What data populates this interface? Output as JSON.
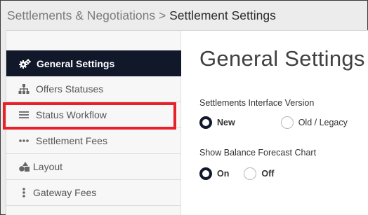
{
  "breadcrumb": {
    "parent": "Settlements & Negotiations",
    "separator": ">",
    "current": "Settlement Settings"
  },
  "sidebar": {
    "items": [
      {
        "label": "General Settings",
        "icon": "gears-icon",
        "active": true
      },
      {
        "label": "Offers Statuses",
        "icon": "sitemap-icon",
        "active": false
      },
      {
        "label": "Status Workflow",
        "icon": "bars-icon",
        "active": false
      },
      {
        "label": "Settlement Fees",
        "icon": "ellipsis-icon",
        "active": false
      },
      {
        "label": "Layout",
        "icon": "shapes-icon",
        "active": false
      },
      {
        "label": "Gateway Fees",
        "icon": "vertical-ellipsis-icon",
        "active": false
      }
    ]
  },
  "main": {
    "title": "General Settings",
    "interface_version": {
      "label": "Settlements Interface Version",
      "options": [
        "New",
        "Old / Legacy"
      ],
      "selected": "New"
    },
    "balance_forecast": {
      "label": "Show Balance Forecast Chart",
      "options": [
        "On",
        "Off"
      ],
      "selected": "On"
    }
  },
  "colors": {
    "active_nav_bg": "#10182a",
    "highlight": "#e8202a"
  }
}
